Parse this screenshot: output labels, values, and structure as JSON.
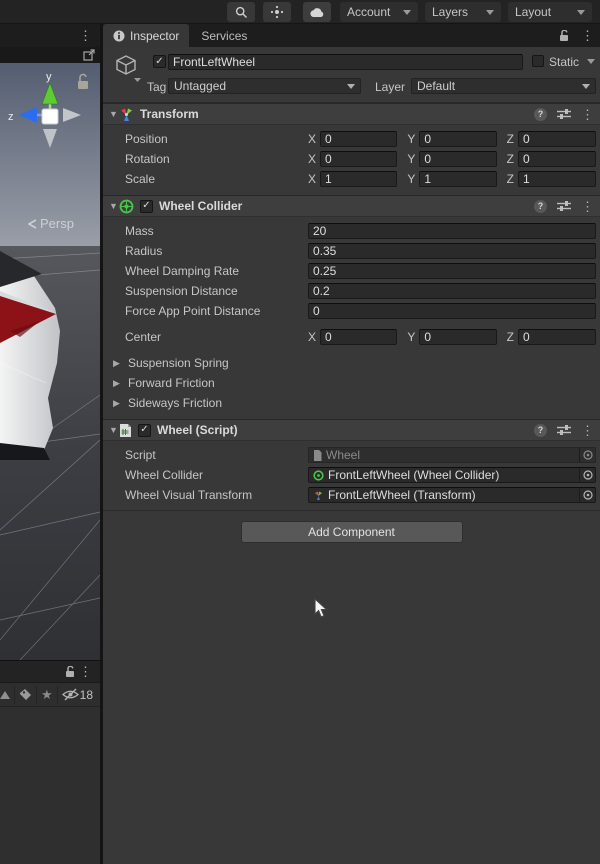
{
  "toolbar": {
    "account_label": "Account",
    "layers_label": "Layers",
    "layout_label": "Layout"
  },
  "tabs": {
    "inspector": "Inspector",
    "services": "Services"
  },
  "go_header": {
    "name": "FrontLeftWheel",
    "static_label": "Static",
    "tag_label": "Tag",
    "tag_value": "Untagged",
    "layer_label": "Layer",
    "layer_value": "Default"
  },
  "transform": {
    "title": "Transform",
    "axis": {
      "x": "X",
      "y": "Y",
      "z": "Z"
    },
    "rows": [
      {
        "label": "Position",
        "x": "0",
        "y": "0",
        "z": "0"
      },
      {
        "label": "Rotation",
        "x": "0",
        "y": "0",
        "z": "0"
      },
      {
        "label": "Scale",
        "x": "1",
        "y": "1",
        "z": "1"
      }
    ]
  },
  "wheel_collider": {
    "title": "Wheel Collider",
    "fields": [
      {
        "label": "Mass",
        "value": "20"
      },
      {
        "label": "Radius",
        "value": "0.35"
      },
      {
        "label": "Wheel Damping Rate",
        "value": "0.25"
      },
      {
        "label": "Suspension Distance",
        "value": "0.2"
      },
      {
        "label": "Force App Point Distance",
        "value": "0"
      }
    ],
    "center": {
      "label": "Center",
      "x": "0",
      "y": "0",
      "z": "0"
    },
    "foldouts": [
      "Suspension Spring",
      "Forward Friction",
      "Sideways Friction"
    ]
  },
  "wheel_script": {
    "title": "Wheel (Script)",
    "script_label": "Script",
    "script_value": "Wheel",
    "fields": [
      {
        "label": "Wheel Collider",
        "value": "FrontLeftWheel (Wheel Collider)"
      },
      {
        "label": "Wheel Visual Transform",
        "value": "FrontLeftWheel (Transform)"
      }
    ]
  },
  "add_component_label": "Add Component",
  "scene": {
    "persp_label": "Persp",
    "axis_y_label": "y",
    "axis_z_label": "z",
    "hidden_count": "18"
  },
  "colors": {
    "wheel_collider_green": "#4ac54a",
    "taillight_red": "#8c1217",
    "axis_y_green": "#5ecb35",
    "axis_z_blue": "#2a6df0",
    "inspector_bg": "#383838",
    "field_bg": "#2a2a2a"
  }
}
